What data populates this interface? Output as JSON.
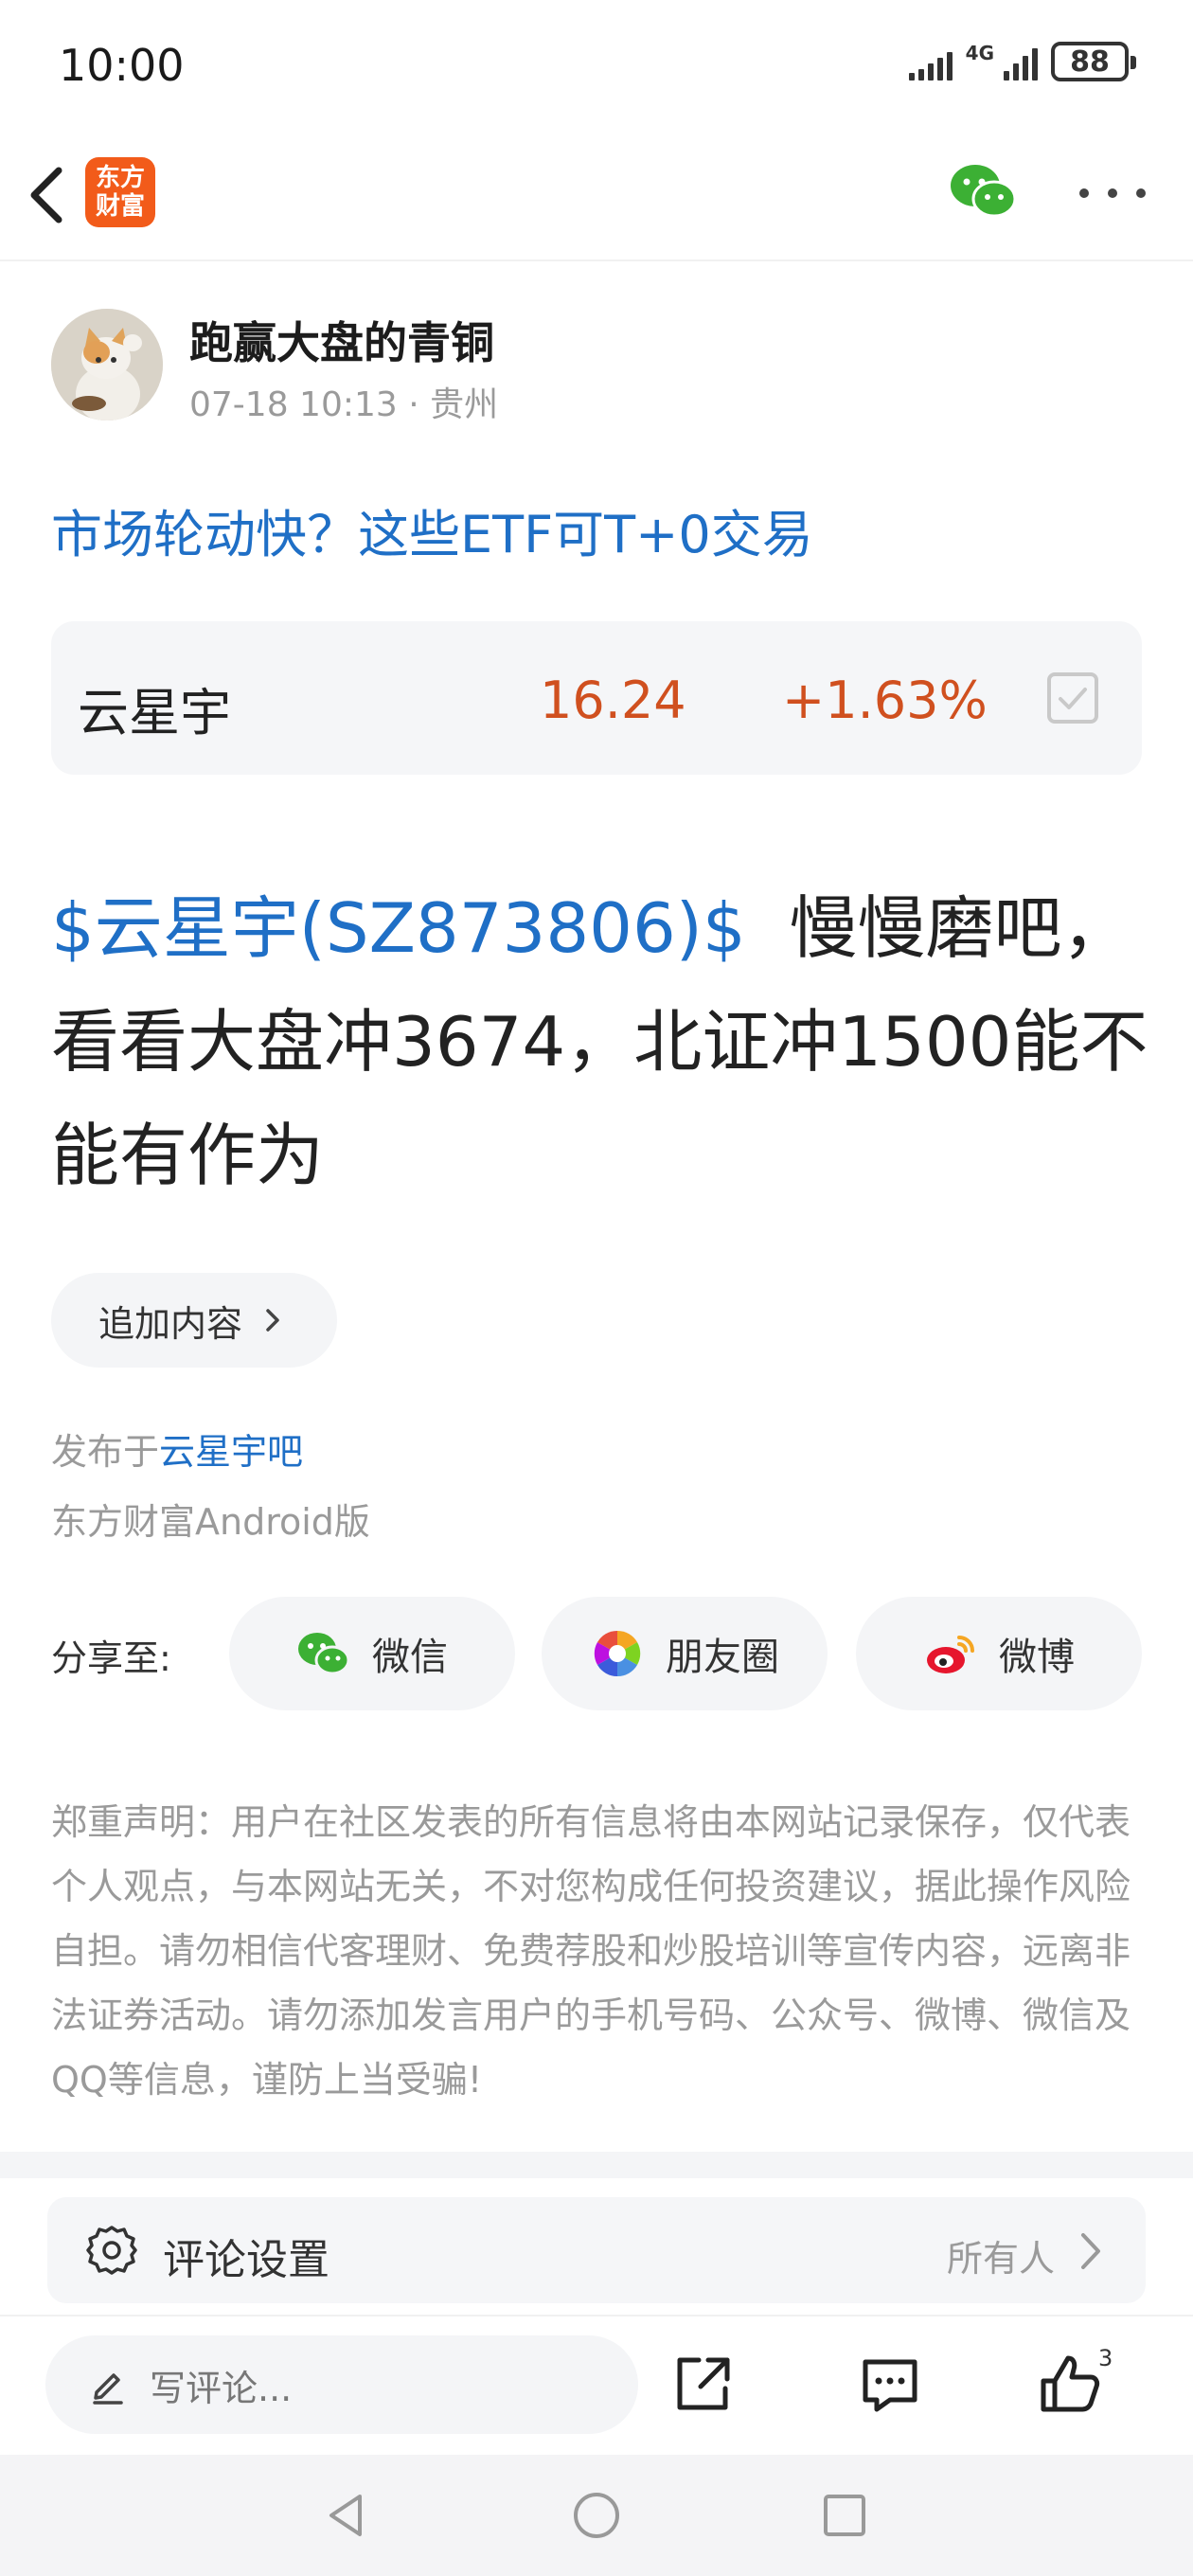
{
  "status_bar": {
    "time": "10:00",
    "network": "4G",
    "battery": "88"
  },
  "nav": {
    "logo_text": "东方\n财富",
    "icons": [
      "back-arrow-icon",
      "wechat-icon",
      "more-icon"
    ]
  },
  "author": {
    "name": "跑赢大盘的青铜",
    "meta": "07-18 10:13 · 贵州"
  },
  "post": {
    "title": "市场轮动快？这些ETF可T+0交易",
    "stock": {
      "name": "云星宇",
      "price": "16.24",
      "change": "+1.63%"
    },
    "body_tag": "$云星宇(SZ873806)$",
    "body_text": "  慢慢磨吧，看看大盘冲3674，北证冲1500能不能有作为",
    "append_label": "追加内容",
    "published_prefix": "发布于",
    "published_bar": "云星宇吧",
    "client": "东方财富Android版"
  },
  "share": {
    "label": "分享至:",
    "buttons": [
      {
        "label": "微信"
      },
      {
        "label": "朋友圈"
      },
      {
        "label": "微博"
      }
    ]
  },
  "disclaimer": "郑重声明：用户在社区发表的所有信息将由本网站记录保存，仅代表个人观点，与本网站无关，不对您构成任何投资建议，据此操作风险自担。请勿相信代客理财、免费荐股和炒股培训等宣传内容，远离非法证券活动。请勿添加发言用户的手机号码、公众号、微博、微信及QQ等信息，谨防上当受骗!",
  "comment_settings": {
    "label": "评论设置",
    "value": "所有人"
  },
  "toolbar": {
    "comment_placeholder": "写评论...",
    "like_count": "3"
  },
  "colors": {
    "link_blue": "#1f6fc6",
    "up_red": "#d0501f",
    "brand_orange": "#f25b1a",
    "wechat_green": "#3cb034"
  }
}
